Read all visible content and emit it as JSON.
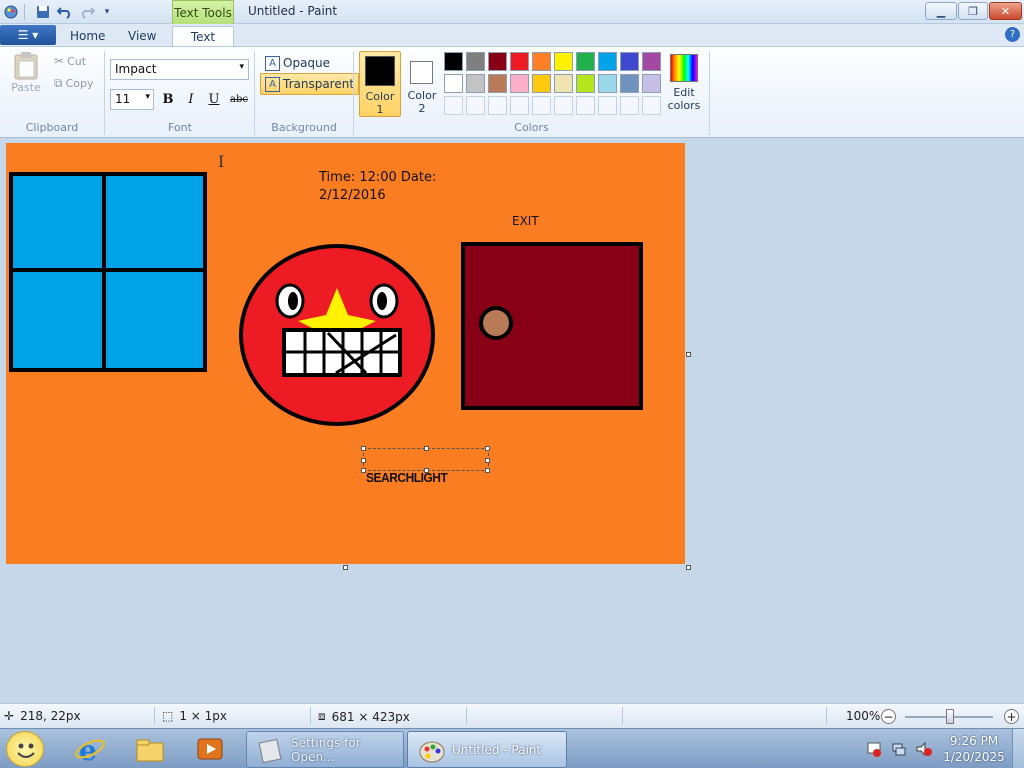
{
  "window": {
    "title": "Untitled - Paint",
    "contextual_tab_group": "Text Tools"
  },
  "tabs": [
    {
      "label": "Home"
    },
    {
      "label": "View"
    },
    {
      "label": "Text"
    }
  ],
  "ribbon": {
    "clipboard": {
      "label": "Clipboard",
      "paste": "Paste",
      "cut": "Cut",
      "copy": "Copy"
    },
    "font": {
      "label": "Font",
      "family": "Impact",
      "size": "11",
      "bold": "B",
      "italic": "I",
      "underline": "U",
      "strikethrough": "abc"
    },
    "background": {
      "label": "Background",
      "opaque": "Opaque",
      "transparent": "Transparent"
    },
    "colors": {
      "label": "Colors",
      "color1": "Color\n1",
      "color1_line1": "Color",
      "color1_line2": "1",
      "color2_line1": "Color",
      "color2_line2": "2",
      "edit_colors_line1": "Edit",
      "edit_colors_line2": "colors",
      "color1_value": "#000000",
      "color2_value": "#ffffff",
      "palette_row1": [
        "#000000",
        "#7f7f7f",
        "#880015",
        "#ed1c24",
        "#ff7f27",
        "#fff200",
        "#22b14c",
        "#00a2e8",
        "#3f48cc",
        "#a349a4"
      ],
      "palette_row2": [
        "#ffffff",
        "#c3c3c3",
        "#b97a57",
        "#ffaec9",
        "#ffc90e",
        "#efe4b0",
        "#b5e61d",
        "#99d9ea",
        "#7092be",
        "#c8bfe7"
      ]
    }
  },
  "canvas": {
    "background_color": "#fb7d22",
    "time_text_line1": "Time: 12:00 Date:",
    "time_text_line2": "2/12/2016",
    "exit_text": "EXIT",
    "searchlight_text": "SEARCHLIGHT",
    "window_color": "#00a2e8",
    "door_color": "#880015",
    "knob_color": "#b97a57",
    "face_color": "#ed1c24",
    "star_color": "#fff200"
  },
  "status": {
    "cursor_position": "218, 22px",
    "selection_size": "1 × 1px",
    "image_size": "681 × 423px",
    "zoom": "100%"
  },
  "taskbar": {
    "apps": [
      {
        "label": "Settings for Open..."
      },
      {
        "label": "Untitled - Paint"
      }
    ],
    "time": "9:26 PM",
    "date": "1/20/2025"
  }
}
